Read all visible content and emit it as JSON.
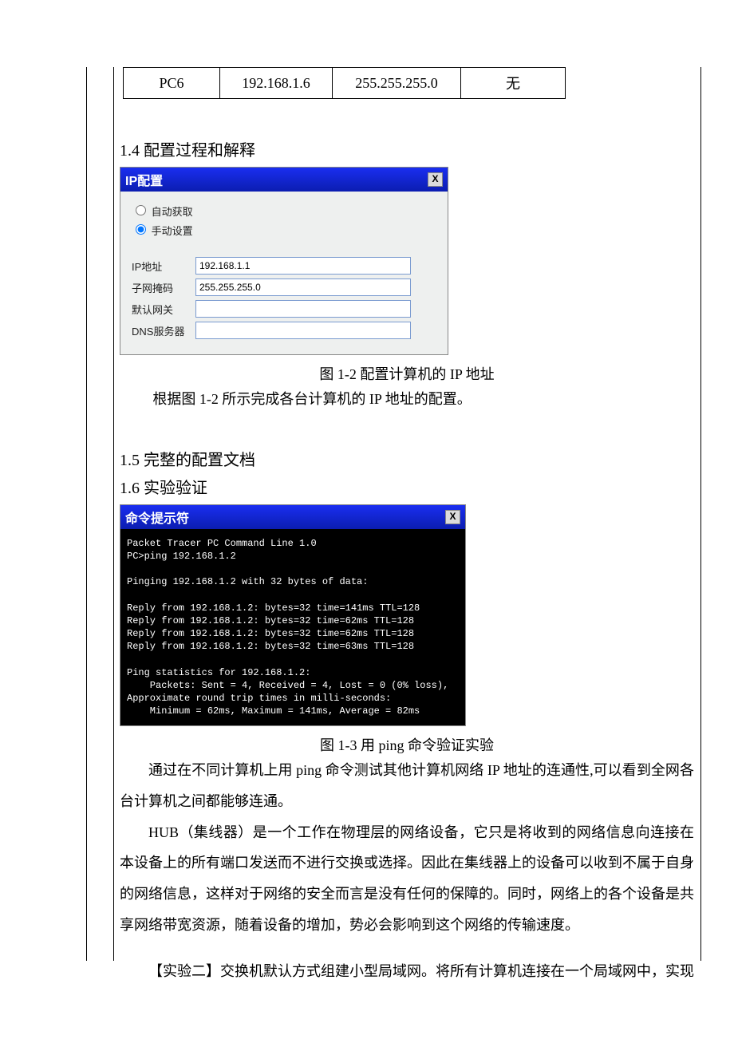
{
  "table": {
    "row": [
      "PC6",
      "192.168.1.6",
      "255.255.255.0",
      "无"
    ]
  },
  "sections": {
    "s14": "1.4 配置过程和解释",
    "s15": "1.5 完整的配置文档",
    "s16": "1.6 实验验证"
  },
  "ipwin": {
    "title": "IP配置",
    "close": "X",
    "opt_dhcp": "自动获取",
    "opt_static": "手动设置",
    "ip_label": "IP地址",
    "ip_value": "192.168.1.1",
    "mask_label": "子网掩码",
    "mask_value": "255.255.255.0",
    "gw_label": "默认网关",
    "gw_value": "",
    "dns_label": "DNS服务器",
    "dns_value": ""
  },
  "fig12": "图 1-2 配置计算机的 IP 地址",
  "para12": "根据图 1-2 所示完成各台计算机的 IP 地址的配置。",
  "cmdwin": {
    "title": "命令提示符",
    "close": "X",
    "text": "Packet Tracer PC Command Line 1.0\nPC>ping 192.168.1.2\n\nPinging 192.168.1.2 with 32 bytes of data:\n\nReply from 192.168.1.2: bytes=32 time=141ms TTL=128\nReply from 192.168.1.2: bytes=32 time=62ms TTL=128\nReply from 192.168.1.2: bytes=32 time=62ms TTL=128\nReply from 192.168.1.2: bytes=32 time=63ms TTL=128\n\nPing statistics for 192.168.1.2:\n    Packets: Sent = 4, Received = 4, Lost = 0 (0% loss),\nApproximate round trip times in milli-seconds:\n    Minimum = 62ms, Maximum = 141ms, Average = 82ms"
  },
  "fig13": "图 1-3 用 ping 命令验证实验",
  "para_a": "通过在不同计算机上用 ping 命令测试其他计算机网络 IP 地址的连通性,可以看到全网各台计算机之间都能够连通。",
  "para_b": "HUB（集线器）是一个工作在物理层的网络设备，它只是将收到的网络信息向连接在本设备上的所有端口发送而不进行交换或选择。因此在集线器上的设备可以收到不属于自身的网络信息，这样对于网络的安全而言是没有任何的保障的。同时，网络上的各个设备是共享网络带宽资源，随着设备的增加，势必会影响到这个网络的传输速度。",
  "para_c": "【实验二】交换机默认方式组建小型局域网。将所有计算机连接在一个局域网中，实现"
}
